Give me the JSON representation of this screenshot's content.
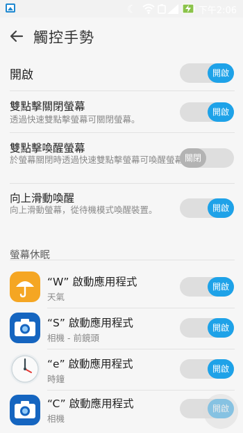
{
  "status_bar": {
    "time": "下午2:06",
    "icons": [
      "gallery-icon",
      "moon-icon",
      "wifi-icon",
      "battery-saver-icon",
      "signal-icon",
      "battery-charging-icon"
    ]
  },
  "header": {
    "back_icon": "arrow-left-icon",
    "title": "觸控手勢"
  },
  "settings": [
    {
      "label": "開啟",
      "description": "",
      "toggle": "開啟",
      "on": true
    },
    {
      "label": "雙點擊關閉螢幕",
      "description": "透過快速雙點擊螢幕可關閉螢幕。",
      "toggle": "開啟",
      "on": true
    },
    {
      "label": "雙點擊喚醒螢幕",
      "description": "於螢幕關閉時透過快速雙點擊螢幕可喚醒螢幕。",
      "toggle": "關閉",
      "on": false
    },
    {
      "label": "向上滑動喚醒",
      "description": "向上滑動螢幕，從待機模式喚醒裝置。",
      "toggle": "開啟",
      "on": true
    }
  ],
  "section": {
    "title": "螢幕休眠"
  },
  "gesture_apps": [
    {
      "label": "“W” 啟動應用程式",
      "app": "天氣",
      "icon": "weather-umbrella-icon",
      "toggle": "開啟",
      "on": true
    },
    {
      "label": "“S” 啟動應用程式",
      "app": "相機 - 前鏡頭",
      "icon": "camera-icon",
      "toggle": "開啟",
      "on": true
    },
    {
      "label": "“e” 啟動應用程式",
      "app": "時鐘",
      "icon": "clock-icon",
      "toggle": "開啟",
      "on": true
    },
    {
      "label": "“C” 啟動應用程式",
      "app": "相機",
      "icon": "camera-icon",
      "toggle": "開啟",
      "on": true
    }
  ],
  "colors": {
    "accent": "#1ea2e8",
    "toggle_off": "#b3b3b3",
    "track": "#dedede",
    "weather": "#f5a623",
    "camera": "#1565c0"
  }
}
